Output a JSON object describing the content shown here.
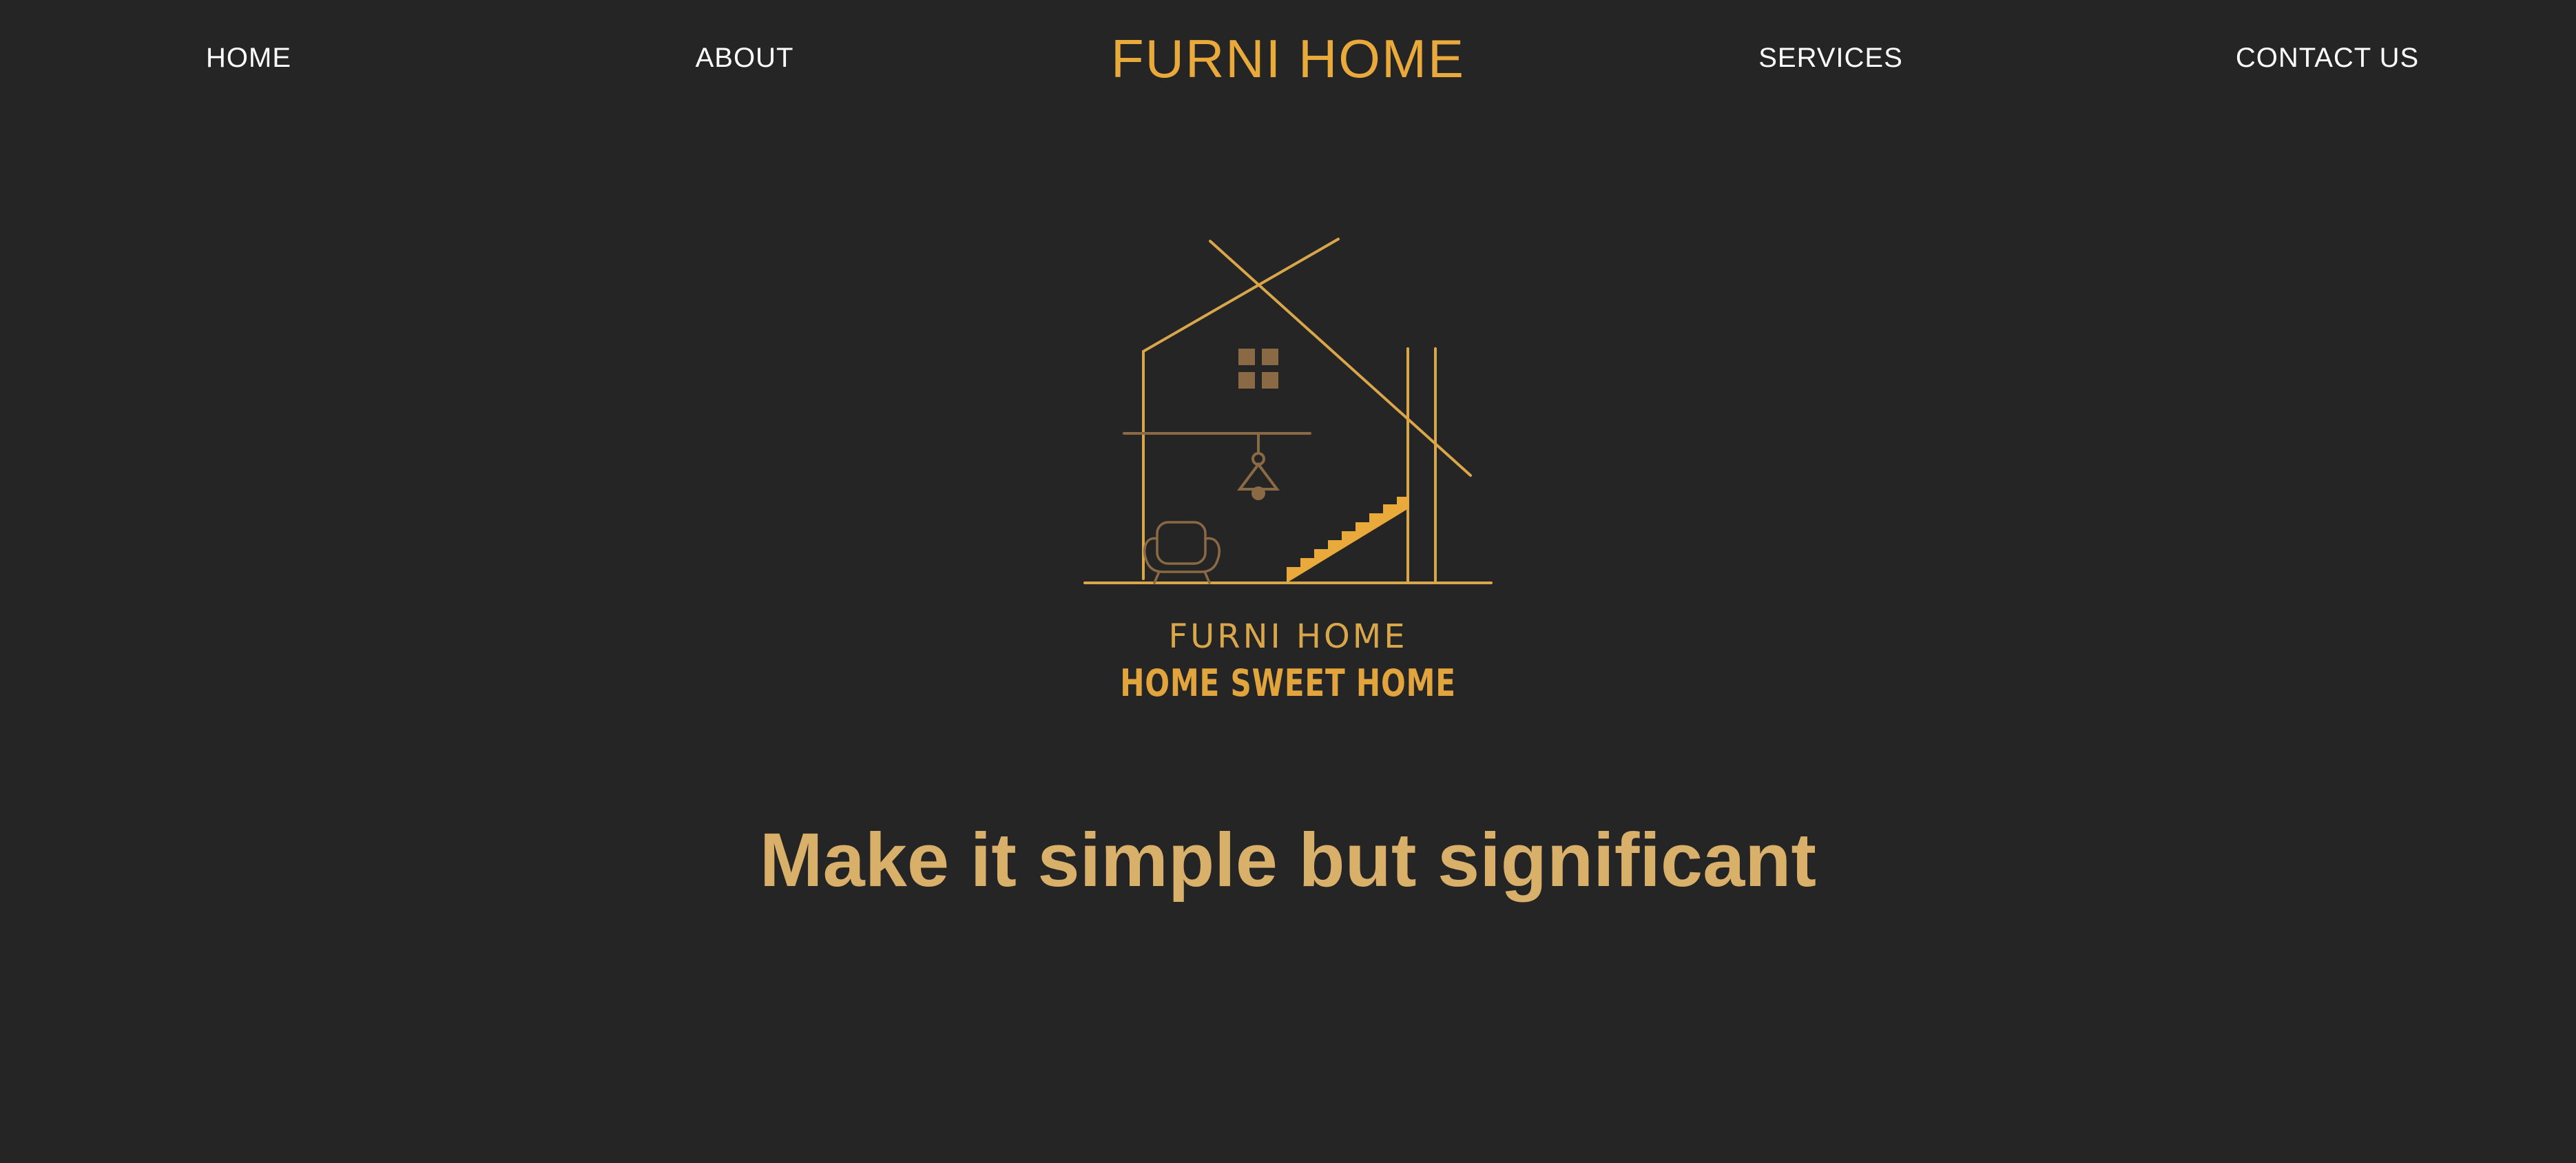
{
  "nav": {
    "home_label": "HOME",
    "about_label": "ABOUT",
    "brand": "FURNI HOME",
    "services_label": "SERVICES",
    "contact_label": "CONTACT US"
  },
  "logo": {
    "name": "FURNI HOME",
    "tagline": "HOME SWEET HOME",
    "icon": "house-with-staircase-icon"
  },
  "hero": {
    "headline": "Make it simple but significant"
  },
  "colors": {
    "background": "#252525",
    "accent": "#e9a93b",
    "headline": "#d9b06a",
    "nav_text": "#ffffff",
    "muted_gold": "#8a6a45"
  }
}
